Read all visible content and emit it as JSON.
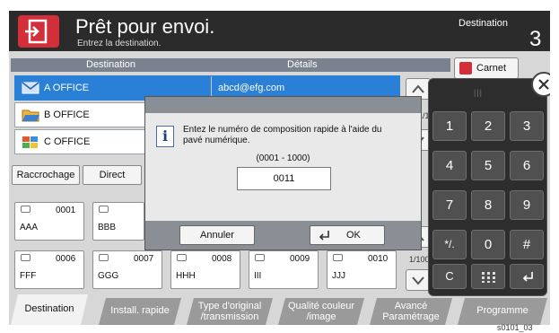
{
  "header": {
    "title": "Prêt pour envoi.",
    "subtitle": "Entrez la destination.",
    "destination_label": "Destination",
    "destination_count": "3"
  },
  "table": {
    "col_destination": "Destination",
    "col_details": "Détails",
    "rows": [
      {
        "name": "A OFFICE",
        "detail": "abcd@efg.com",
        "icon": "email-icon",
        "selected": true
      },
      {
        "name": "B OFFICE",
        "detail": "",
        "icon": "folder-icon",
        "selected": false
      },
      {
        "name": "C OFFICE",
        "detail": "",
        "icon": "group-icon",
        "selected": false
      }
    ],
    "page": "1/1"
  },
  "carnet_label": "Carnet",
  "left_buttons": {
    "raccrochage": "Raccrochage",
    "direct": "Direct"
  },
  "one_touch_keys": [
    {
      "num": "0001",
      "name": "AAA"
    },
    {
      "num": "",
      "name": "BBB"
    },
    {
      "num": "0006",
      "name": "FFF"
    },
    {
      "num": "0007",
      "name": "GGG"
    },
    {
      "num": "0008",
      "name": "HHH"
    },
    {
      "num": "0009",
      "name": "III"
    },
    {
      "num": "0010",
      "name": "JJJ"
    }
  ],
  "one_touch_page": "1/100",
  "dialog": {
    "message": "Entez le numéro de composition rapide à l'aide du pavé numérique.",
    "range": "(0001 - 1000)",
    "input_value": "0011",
    "cancel_label": "Annuler",
    "ok_label": "OK"
  },
  "keypad": {
    "grip": "|||",
    "keys": [
      "1",
      "2",
      "3",
      "4",
      "5",
      "6",
      "7",
      "8",
      "9",
      "*/.",
      "0",
      "#"
    ],
    "bottom": [
      "C",
      "",
      ""
    ]
  },
  "tabs": [
    {
      "label": "Destination",
      "active": true
    },
    {
      "label": "Install. rapide",
      "active": false
    },
    {
      "label": "Type d'original /transmission",
      "active": false
    },
    {
      "label": "Qualité couleur /image",
      "active": false
    },
    {
      "label": "Avancé Paramétrage",
      "active": false
    },
    {
      "label": "Programme",
      "active": false
    }
  ],
  "footer_code": "s0101_03",
  "colors": {
    "accent_red": "#d32f3a",
    "selection_blue": "#2a7fd6",
    "header_bg": "#2b2b2b"
  }
}
